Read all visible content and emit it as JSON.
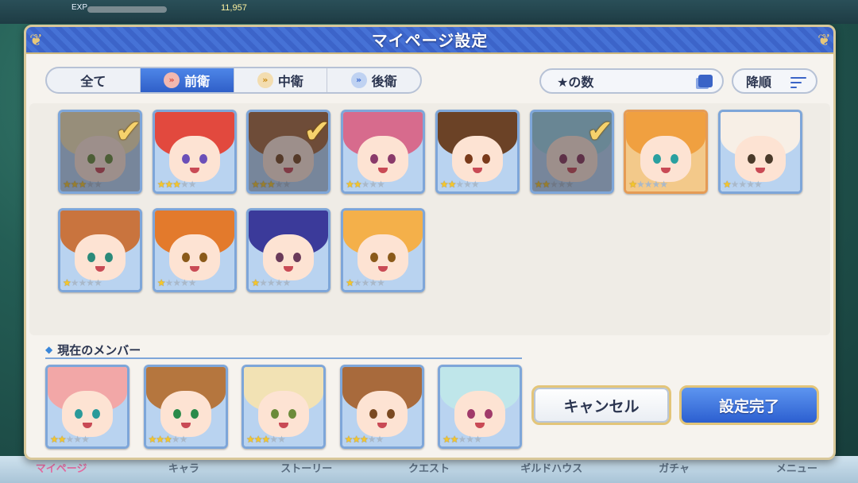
{
  "background": {
    "status_label": "EXP",
    "status_value": "11,957",
    "bottom_nav": [
      "マイページ",
      "キャラ",
      "ストーリー",
      "クエスト",
      "ギルドハウス",
      "ガチャ",
      "メニュー"
    ]
  },
  "dialog": {
    "title": "マイページ設定"
  },
  "filters": {
    "tabs": [
      {
        "label": "全て",
        "icon": "none",
        "active": false
      },
      {
        "label": "前衛",
        "icon": "front-arrow-icon",
        "active": true
      },
      {
        "label": "中衛",
        "icon": "middle-arrow-icon",
        "active": false
      },
      {
        "label": "後衛",
        "icon": "back-arrow-icon",
        "active": false
      }
    ]
  },
  "sort": {
    "count_label": "★の数",
    "order_label": "降順"
  },
  "roster": [
    {
      "stars": 3,
      "max_stars": 5,
      "selected": true,
      "frame": "blue",
      "hair": "#f2e2b4",
      "eyes": "#6b8b3a"
    },
    {
      "stars": 3,
      "max_stars": 5,
      "selected": false,
      "frame": "blue",
      "hair": "#e2493e",
      "eyes": "#6b4fb8"
    },
    {
      "stars": 3,
      "max_stars": 5,
      "selected": true,
      "frame": "blue",
      "hair": "#a86a3c",
      "eyes": "#7a4a22"
    },
    {
      "stars": 2,
      "max_stars": 5,
      "selected": false,
      "frame": "blue",
      "hair": "#d76b8d",
      "eyes": "#8a3a6a"
    },
    {
      "stars": 2,
      "max_stars": 5,
      "selected": false,
      "frame": "blue",
      "hair": "#6b4226",
      "eyes": "#7a3a1a"
    },
    {
      "stars": 2,
      "max_stars": 5,
      "selected": true,
      "frame": "blue",
      "hair": "#9ed4e4",
      "eyes": "#8a3a5a"
    },
    {
      "stars": 1,
      "max_stars": 5,
      "selected": false,
      "frame": "gold",
      "hair": "#f0a040",
      "eyes": "#2aa0a0"
    },
    {
      "stars": 1,
      "max_stars": 5,
      "selected": false,
      "frame": "blue",
      "hair": "#f7efe6",
      "eyes": "#4a3a2a"
    },
    {
      "stars": 1,
      "max_stars": 5,
      "selected": false,
      "frame": "blue",
      "hair": "#c9743e",
      "eyes": "#2a8a7a"
    },
    {
      "stars": 1,
      "max_stars": 5,
      "selected": false,
      "frame": "blue",
      "hair": "#e37a2c",
      "eyes": "#8a5a1a"
    },
    {
      "stars": 1,
      "max_stars": 5,
      "selected": false,
      "frame": "blue",
      "hair": "#3b3a9a",
      "eyes": "#6a3a5a"
    },
    {
      "stars": 1,
      "max_stars": 5,
      "selected": false,
      "frame": "blue",
      "hair": "#f4b04a",
      "eyes": "#8a5a1a"
    }
  ],
  "members": {
    "label": "現在のメンバー",
    "list": [
      {
        "stars": 2,
        "max_stars": 5,
        "hair": "#f2a7a7",
        "eyes": "#2a9a9a"
      },
      {
        "stars": 3,
        "max_stars": 5,
        "hair": "#b5763e",
        "eyes": "#2a8a4a"
      },
      {
        "stars": 3,
        "max_stars": 5,
        "hair": "#f2e2b4",
        "eyes": "#6b8b3a"
      },
      {
        "stars": 3,
        "max_stars": 5,
        "hair": "#a86a3c",
        "eyes": "#7a4a22"
      },
      {
        "stars": 2,
        "max_stars": 5,
        "hair": "#bfe6ea",
        "eyes": "#a03a6a"
      }
    ]
  },
  "buttons": {
    "cancel": "キャンセル",
    "confirm": "設定完了"
  },
  "colors": {
    "header_blue": "#3c64c9",
    "active_tab": "#2f5fc8",
    "frame_blue": "#7ea6d9",
    "frame_gold": "#e59b55",
    "check_gold": "#f6d26c"
  }
}
